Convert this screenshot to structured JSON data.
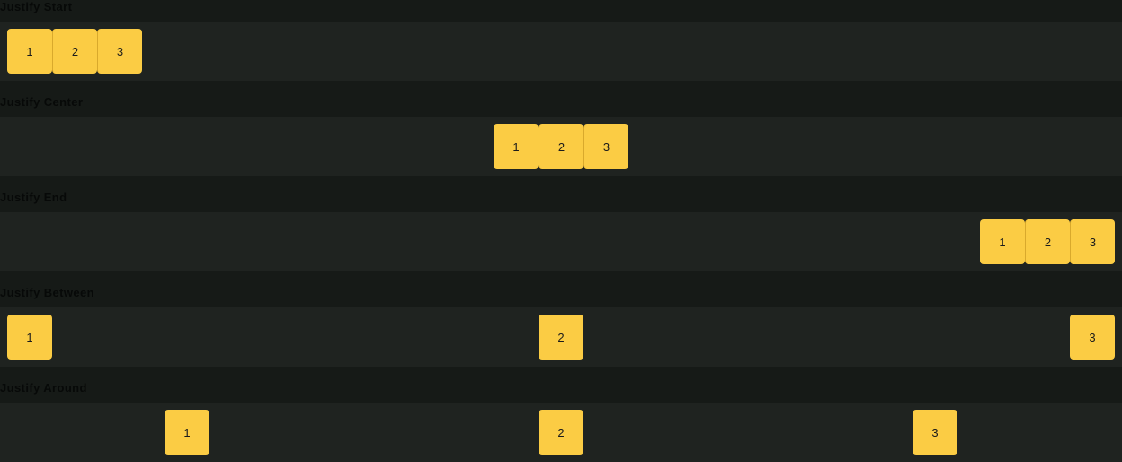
{
  "sections": [
    {
      "label": "Justify Start",
      "items": [
        "1",
        "2",
        "3"
      ]
    },
    {
      "label": "Justify Center",
      "items": [
        "1",
        "2",
        "3"
      ]
    },
    {
      "label": "Justify End",
      "items": [
        "1",
        "2",
        "3"
      ]
    },
    {
      "label": "Justify Between",
      "items": [
        "1",
        "2",
        "3"
      ]
    },
    {
      "label": "Justify Around",
      "items": [
        "1",
        "2",
        "3"
      ]
    }
  ],
  "colors": {
    "page_background": "#161a17",
    "row_background": "#1f2320",
    "box_fill": "#fbcc44",
    "label_text": "#070908"
  }
}
